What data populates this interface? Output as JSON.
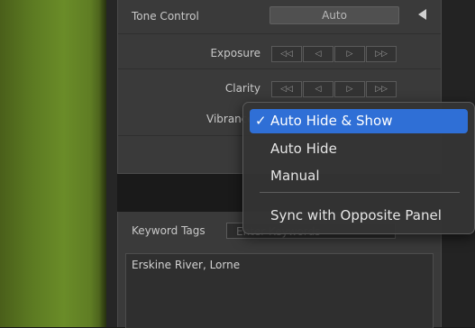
{
  "tone": {
    "label": "Tone Control",
    "auto_button": "Auto"
  },
  "adjustments": [
    {
      "label": "Exposure",
      "buttons": [
        "◁◁",
        "◁",
        "▷",
        "▷▷"
      ]
    },
    {
      "label": "Clarity",
      "buttons": [
        "◁◁",
        "◁",
        "▷",
        "▷▷"
      ]
    },
    {
      "label": "Vibrance"
    }
  ],
  "keyword": {
    "label": "Keyword Tags",
    "placeholder": "Enter Keywords",
    "tags": "Erskine River, Lorne"
  },
  "menu": {
    "items": [
      "Auto Hide & Show",
      "Auto Hide",
      "Manual",
      "Sync with Opposite Panel"
    ],
    "checkmark": "✓",
    "selected_index": 0,
    "highlight_color": "#2f6fd6"
  }
}
